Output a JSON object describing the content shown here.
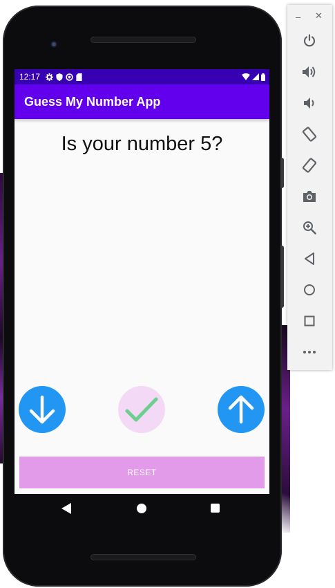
{
  "status_bar": {
    "time": "12:17",
    "icons": [
      "gear-icon",
      "shield-icon",
      "blocked-icon",
      "sd-card-icon"
    ],
    "right_icons": [
      "wifi-icon",
      "signal-icon",
      "battery-icon"
    ]
  },
  "app_bar": {
    "title": "Guess My Number App",
    "color": "#6200ee",
    "status_color": "#3700b3"
  },
  "main": {
    "question": "Is your number 5?"
  },
  "buttons": {
    "lower_icon": "arrow-down-icon",
    "correct_icon": "check-icon",
    "higher_icon": "arrow-up-icon",
    "reset_label": "RESET",
    "blue": "#2196f3",
    "check_bg": "#f3d9f5",
    "check_color": "#6ccf8e",
    "reset_bg": "#e19be9"
  },
  "nav": {
    "icons": [
      "back-icon",
      "home-icon",
      "recents-icon"
    ]
  },
  "toolbar": {
    "window_controls": [
      "minimize-icon",
      "close-icon"
    ],
    "items": [
      "power-icon",
      "volume-up-icon",
      "volume-down-icon",
      "rotate-left-icon",
      "rotate-right-icon",
      "camera-icon",
      "zoom-icon",
      "back-icon",
      "home-icon",
      "overview-icon",
      "more-icon"
    ]
  }
}
